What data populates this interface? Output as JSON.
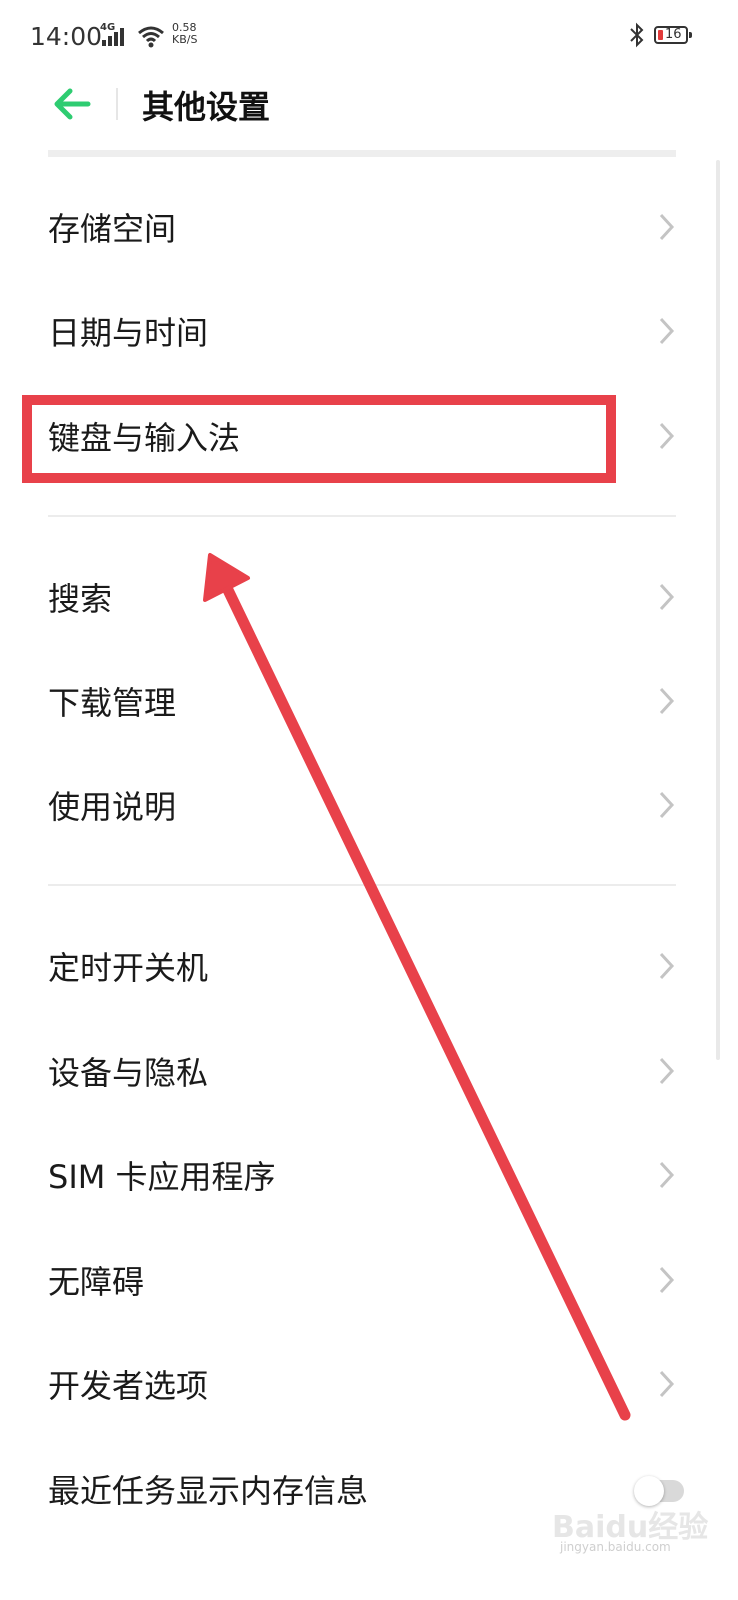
{
  "status_bar": {
    "time": "14:00",
    "network": "4G",
    "speed_value": "0.58",
    "speed_unit": "KB/S",
    "battery": "16"
  },
  "header": {
    "title": "其他设置",
    "back_icon": "arrow-left-icon",
    "accent_color": "#2ecc71"
  },
  "menu": {
    "items": [
      {
        "label": "存储空间"
      },
      {
        "label": "日期与时间"
      },
      {
        "label": "键盘与输入法"
      },
      {
        "label": "搜索"
      },
      {
        "label": "下载管理"
      },
      {
        "label": "使用说明"
      },
      {
        "label": "定时开关机"
      },
      {
        "label": "设备与隐私"
      },
      {
        "label": "SIM 卡应用程序"
      },
      {
        "label": "无障碍"
      },
      {
        "label": "开发者选项"
      },
      {
        "label": "最近任务显示内存信息"
      }
    ]
  },
  "watermark": {
    "text": "Baidu经验",
    "sub": "jingyan.baidu.com"
  },
  "annotation_color": "#e8414a"
}
